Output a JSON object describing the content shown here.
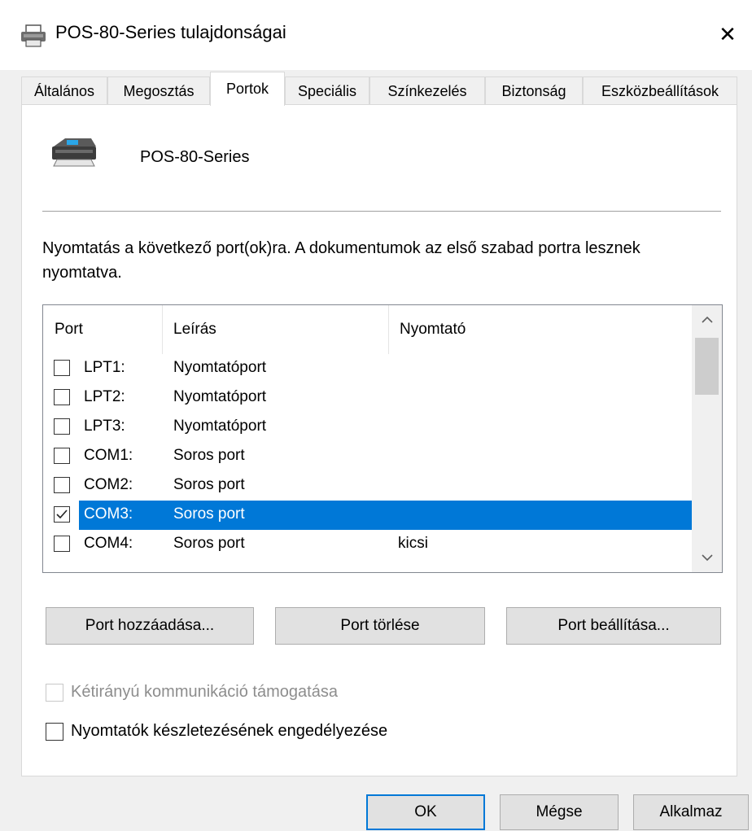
{
  "window": {
    "title": "POS-80-Series tulajdonságai",
    "close_glyph": "✕",
    "icon": "printer-icon"
  },
  "tabs": [
    {
      "label": "Általános",
      "active": false
    },
    {
      "label": "Megosztás",
      "active": false
    },
    {
      "label": "Portok",
      "active": true
    },
    {
      "label": "Speciális",
      "active": false
    },
    {
      "label": "Színkezelés",
      "active": false
    },
    {
      "label": "Biztonság",
      "active": false
    },
    {
      "label": "Eszközbeállítások",
      "active": false
    }
  ],
  "printer": {
    "name": "POS-80-Series",
    "icon": "printer-icon"
  },
  "description": "Nyomtatás a következő port(ok)ra. A dokumentumok az első szabad portra lesznek nyomtatva.",
  "port_list": {
    "columns": [
      "Port",
      "Leírás",
      "Nyomtató"
    ],
    "rows": [
      {
        "port": "LPT1:",
        "desc": "Nyomtatóport",
        "printer": "",
        "checked": false,
        "selected": false
      },
      {
        "port": "LPT2:",
        "desc": "Nyomtatóport",
        "printer": "",
        "checked": false,
        "selected": false
      },
      {
        "port": "LPT3:",
        "desc": "Nyomtatóport",
        "printer": "",
        "checked": false,
        "selected": false
      },
      {
        "port": "COM1:",
        "desc": "Soros port",
        "printer": "",
        "checked": false,
        "selected": false
      },
      {
        "port": "COM2:",
        "desc": "Soros port",
        "printer": "",
        "checked": false,
        "selected": false
      },
      {
        "port": "COM3:",
        "desc": "Soros port",
        "printer": "",
        "checked": true,
        "selected": true
      },
      {
        "port": "COM4:",
        "desc": "Soros port",
        "printer": "kicsi",
        "checked": false,
        "selected": false
      }
    ],
    "scroll_up": "^",
    "scroll_down": "⌄"
  },
  "port_buttons": {
    "add": "Port hozzáadása...",
    "delete": "Port törlése",
    "configure": "Port beállítása..."
  },
  "options": {
    "bidirectional": {
      "label": "Kétirányú kommunikáció támogatása",
      "checked": false,
      "disabled": true
    },
    "pooling": {
      "label": "Nyomtatók készletezésének engedélyezése",
      "checked": false,
      "disabled": false
    }
  },
  "dialog_buttons": {
    "ok": "OK",
    "cancel": "Mégse",
    "apply": "Alkalmaz"
  },
  "colors": {
    "accent": "#0078d7",
    "selection": "#0078d7"
  }
}
